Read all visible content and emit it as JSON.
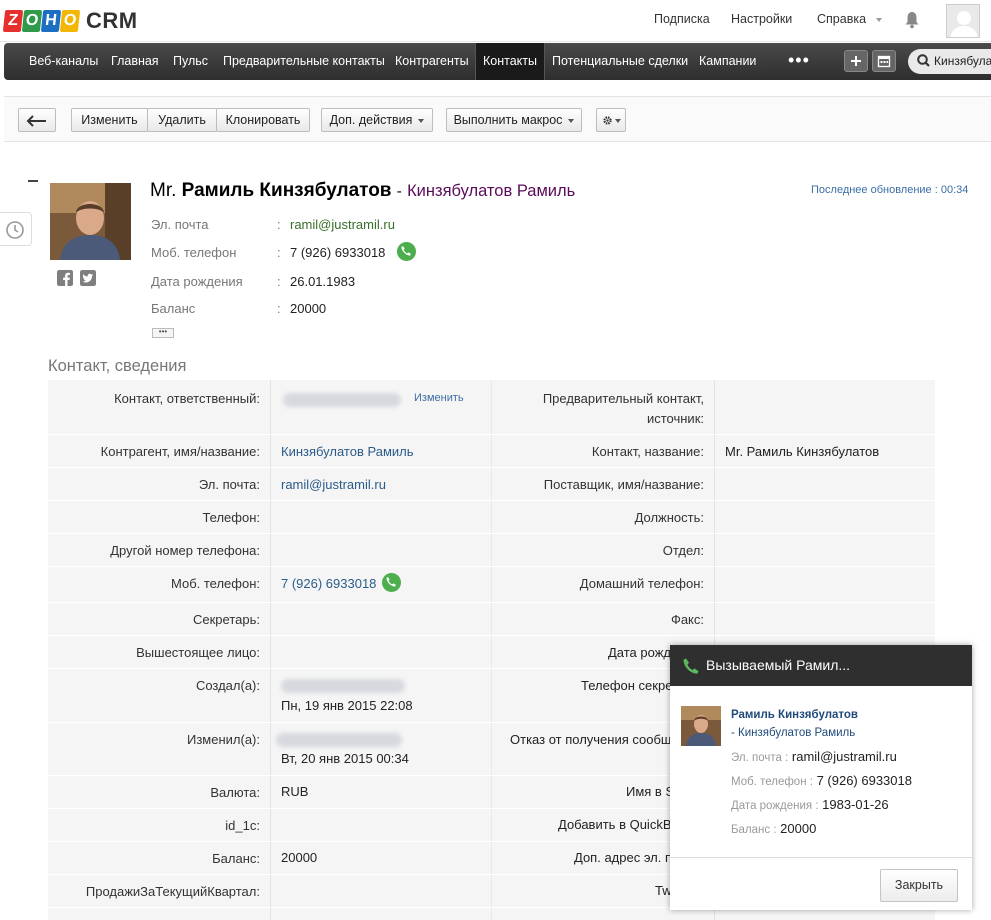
{
  "app": {
    "logo_letters": [
      "Z",
      "O",
      "H",
      "O"
    ],
    "logo_colors": [
      "#e4312c",
      "#2f9b4a",
      "#1c6fc2",
      "#f2b705"
    ],
    "logo_text": "CRM"
  },
  "topbar": {
    "subscribe": "Подписка",
    "settings": "Настройки",
    "help": "Справка",
    "bell_icon": "bell-icon",
    "avatar_icon": "user-avatar-icon"
  },
  "nav": {
    "items": [
      {
        "label": "Веб-каналы"
      },
      {
        "label": "Главная"
      },
      {
        "label": "Пульс"
      },
      {
        "label": "Предварительные контакты"
      },
      {
        "label": "Контрагенты"
      },
      {
        "label": "Контакты",
        "active": true
      },
      {
        "label": "Потенциальные сделки"
      },
      {
        "label": "Кампании"
      }
    ],
    "more": "•••",
    "add_icon": "plus-icon",
    "calendar_icon": "calendar-icon",
    "search_value": "Кинзябулатов"
  },
  "toolbar": {
    "back_icon": "arrow-left-icon",
    "edit": "Изменить",
    "delete": "Удалить",
    "clone": "Клонировать",
    "more_actions": "Доп. действия",
    "run_macro": "Выполнить макрос",
    "settings_icon": "gear-icon"
  },
  "record": {
    "salutation": "Mr.",
    "name": "Рамиль Кинзябулатов",
    "separator": "-",
    "account": "Кинзябулатов Рамиль",
    "last_updated_label": "Последнее обновление",
    "last_updated_value": ": 00:34",
    "header_fields": [
      {
        "label": "Эл. почта",
        "value": "ramil@justramil.ru",
        "link": true
      },
      {
        "label": "Моб. телефон",
        "value": "7 (926) 6933018"
      },
      {
        "label": "Дата рождения",
        "value": "26.01.1983"
      },
      {
        "label": "Баланс",
        "value": "20000"
      }
    ],
    "colon": ":",
    "more_label": "•••"
  },
  "section": {
    "title": "Контакт, сведения",
    "change_link": "Изменить",
    "left": [
      {
        "label": "Контакт, ответственный:",
        "value": ""
      },
      {
        "label": "Контрагент, имя/название:",
        "value": "Кинзябулатов Рамиль"
      },
      {
        "label": "Эл. почта:",
        "value": "ramil@justramil.ru"
      },
      {
        "label": "Телефон:",
        "value": ""
      },
      {
        "label": "Другой номер телефона:",
        "value": ""
      },
      {
        "label": "Моб. телефон:",
        "value": "7 (926) 6933018"
      },
      {
        "label": "Секретарь:",
        "value": ""
      },
      {
        "label": "Вышестоящее лицо:",
        "value": ""
      },
      {
        "label": "Создал(а):",
        "value": "Пн, 19 янв 2015 22:08"
      },
      {
        "label": "Изменил(а):",
        "value": "Вт, 20 янв 2015 00:34"
      },
      {
        "label": "Валюта:",
        "value": "RUB"
      },
      {
        "label": "id_1c:",
        "value": ""
      },
      {
        "label": "Баланс:",
        "value": "20000"
      },
      {
        "label": "ПродажиЗаТекущийКвартал:",
        "value": ""
      }
    ],
    "right": [
      {
        "label": "Предварительный контакт,",
        "label2": "источник:",
        "value": ""
      },
      {
        "label": "Контакт, название:",
        "value": "Mr. Рамиль Кинзябулатов"
      },
      {
        "label": "Поставщик, имя/название:",
        "value": ""
      },
      {
        "label": "Должность:",
        "value": ""
      },
      {
        "label": "Отдел:",
        "value": ""
      },
      {
        "label": "Домашний телефон:",
        "value": ""
      },
      {
        "label": "Факс:",
        "value": ""
      },
      {
        "label": "Дата рожд",
        "value": ""
      },
      {
        "label": "Телефон секре",
        "value": ""
      },
      {
        "label": "Отказ от получения сообщ",
        "value": ""
      },
      {
        "label": "Имя в S",
        "value": ""
      },
      {
        "label": "Добавить в QuickB",
        "value": ""
      },
      {
        "label": "Доп. адрес эл. п",
        "value": ""
      },
      {
        "label": "Tw",
        "value": ""
      }
    ]
  },
  "call_popup": {
    "title": "Вызываемый Рамил...",
    "name": "Рамиль Кинзябулатов",
    "account": "- Кинзябулатов Рамиль",
    "lines": [
      {
        "label": "Эл. почта :",
        "value": "ramil@justramil.ru"
      },
      {
        "label": "Моб. телефон :",
        "value": "7 (926) 6933018"
      },
      {
        "label": "Дата рождения :",
        "value": "1983-01-26"
      },
      {
        "label": "Баланс :",
        "value": "20000"
      }
    ],
    "close": "Закрыть"
  }
}
